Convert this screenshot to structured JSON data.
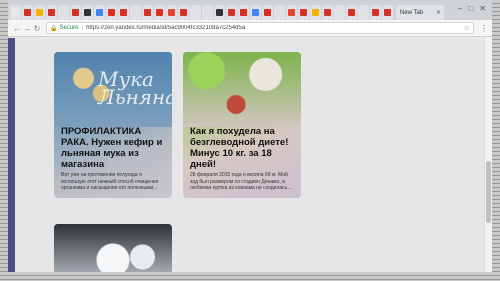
{
  "browser": {
    "tabs": [
      {
        "color": "#e8e8e8"
      },
      {
        "color": "#d93025"
      },
      {
        "color": "#f4b400"
      },
      {
        "color": "#d93025"
      },
      {
        "color": "#e0e0e0"
      },
      {
        "color": "#d93025"
      },
      {
        "color": "#333333"
      },
      {
        "color": "#4285f4"
      },
      {
        "color": "#d93025"
      },
      {
        "color": "#d93025"
      },
      {
        "color": "#e0e0e0"
      },
      {
        "color": "#d93025"
      },
      {
        "color": "#d93025"
      },
      {
        "color": "#ea4335"
      },
      {
        "color": "#d93025"
      },
      {
        "color": "#e0e0e0"
      },
      {
        "color": "#e0e0e0"
      },
      {
        "color": "#333333"
      },
      {
        "color": "#d93025"
      },
      {
        "color": "#d93025"
      },
      {
        "color": "#4285f4"
      },
      {
        "color": "#d93025"
      },
      {
        "color": "#e0e0e0"
      },
      {
        "color": "#ea4335"
      },
      {
        "color": "#d93025"
      },
      {
        "color": "#f4b400"
      },
      {
        "color": "#d93025"
      },
      {
        "color": "#e0e0e0"
      },
      {
        "color": "#d93025"
      },
      {
        "color": "#e0e0e0"
      },
      {
        "color": "#d93025"
      },
      {
        "color": "#d93025"
      }
    ],
    "new_tab_label": "New Tab",
    "url_security_label": "Secure",
    "url": "https://zen.yandex.ru/media/id/5ac9004fc332108a7c254d5a"
  },
  "feed": {
    "cards": [
      {
        "logo_text": "Мука Льняная",
        "title": "ПРОФИЛАКТИКА РАКА. Нужен кефир и льняная мука из магазина",
        "description": "Вот уже на протяжении полугода я использую этот нежный способ очищения организма и насыщения его полезными..."
      },
      {
        "title": "Как я похудела на безглеводной диете! Минус 10 кг. за 18 дней!",
        "description": "28 февраля 2015 года я весила 68 кг. Мой зад был размером со стадион Динамо, а любимая куртка из кожзама не сходилась..."
      }
    ]
  },
  "colors": {
    "accent_left_strip": "#4a4f8c",
    "secure_green": "#1e8e3e"
  }
}
